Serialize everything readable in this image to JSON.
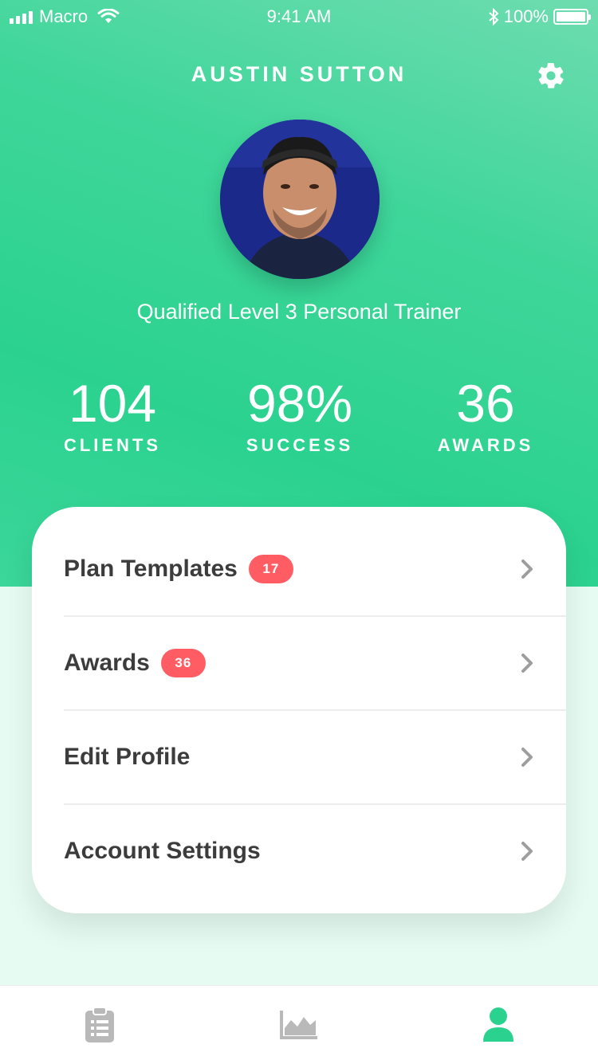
{
  "status_bar": {
    "carrier": "Macro",
    "time": "9:41 AM",
    "battery": "100%"
  },
  "header": {
    "title": "AUSTIN SUTTON"
  },
  "profile": {
    "subtitle": "Qualified Level 3 Personal Trainer"
  },
  "stats": [
    {
      "value": "104",
      "label": "CLIENTS"
    },
    {
      "value": "98%",
      "label": "SUCCESS"
    },
    {
      "value": "36",
      "label": "AWARDS"
    }
  ],
  "menu": [
    {
      "label": "Plan Templates",
      "badge": "17"
    },
    {
      "label": "Awards",
      "badge": "36"
    },
    {
      "label": "Edit Profile"
    },
    {
      "label": "Account Settings"
    }
  ],
  "tabs": [
    {
      "icon": "clipboard-icon"
    },
    {
      "icon": "chart-icon"
    },
    {
      "icon": "profile-icon",
      "active": true
    }
  ],
  "colors": {
    "accent": "#2bd28f",
    "badge": "#ff5c63",
    "tab_inactive": "#b9b9b9",
    "tab_active": "#2bd28f"
  }
}
